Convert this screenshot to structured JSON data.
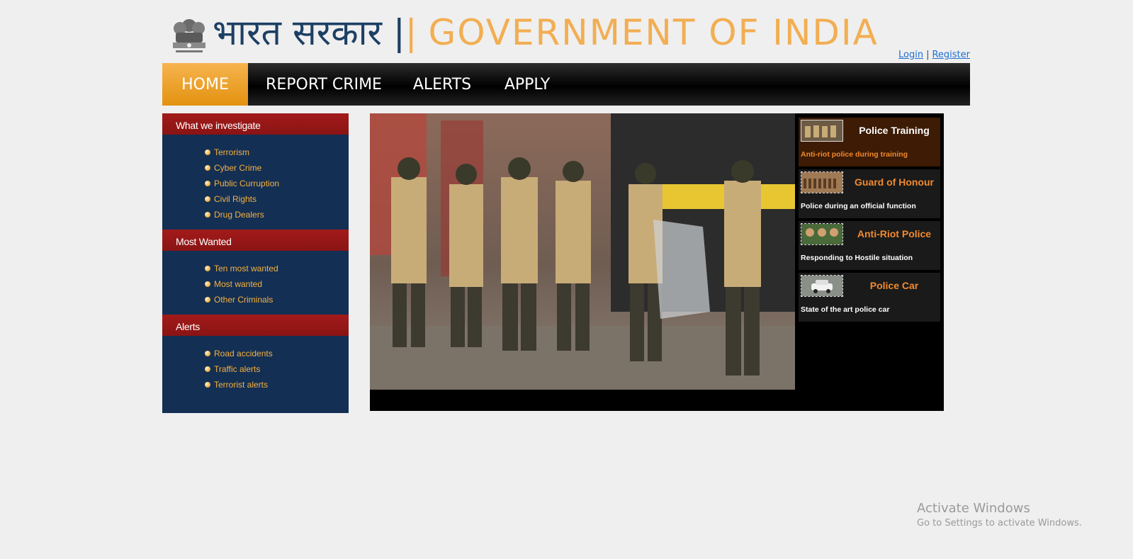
{
  "header": {
    "hindi_title": "भारत सरकार",
    "sep1": "|",
    "sep2": "|",
    "english_title": "GOVERNMENT OF INDIA",
    "emblem_icon": "national-emblem-icon"
  },
  "auth": {
    "login": "Login",
    "separator": "|",
    "register": "Register"
  },
  "nav": {
    "home": "HOME",
    "report_crime": "REPORT CRIME",
    "alerts": "ALERTS",
    "apply": "APPLY"
  },
  "sidebar": {
    "sections": [
      {
        "title": "What we investigate",
        "items": [
          "Terrorism",
          "Cyber Crime",
          "Public Curruption",
          "Civil Rights",
          "Drug Dealers"
        ]
      },
      {
        "title": "Most Wanted",
        "items": [
          "Ten most wanted",
          "Most wanted",
          "Other Criminals"
        ]
      },
      {
        "title": "Alerts",
        "items": [
          "Road accidents",
          "Traffic alerts",
          "Terrorist alerts"
        ]
      }
    ]
  },
  "gallery": {
    "main_photo": "police-team-photo",
    "thumbs": [
      {
        "title": "Police Training",
        "desc": "Anti-riot police during training"
      },
      {
        "title": "Guard of Honour",
        "desc": "Police during an official function"
      },
      {
        "title": "Anti-Riot Police",
        "desc": "Responding to Hostile situation"
      },
      {
        "title": "Police Car",
        "desc": "State of the art police car"
      }
    ]
  },
  "watermark": {
    "line1": "Activate Windows",
    "line2": "Go to Settings to activate Windows."
  },
  "colors": {
    "accent_orange": "#f2ae52",
    "title_blue": "#1c3f64",
    "sidebar_bg": "#132f54",
    "sidebar_head": "#a31a1a",
    "link_orange": "#f6b13e"
  }
}
